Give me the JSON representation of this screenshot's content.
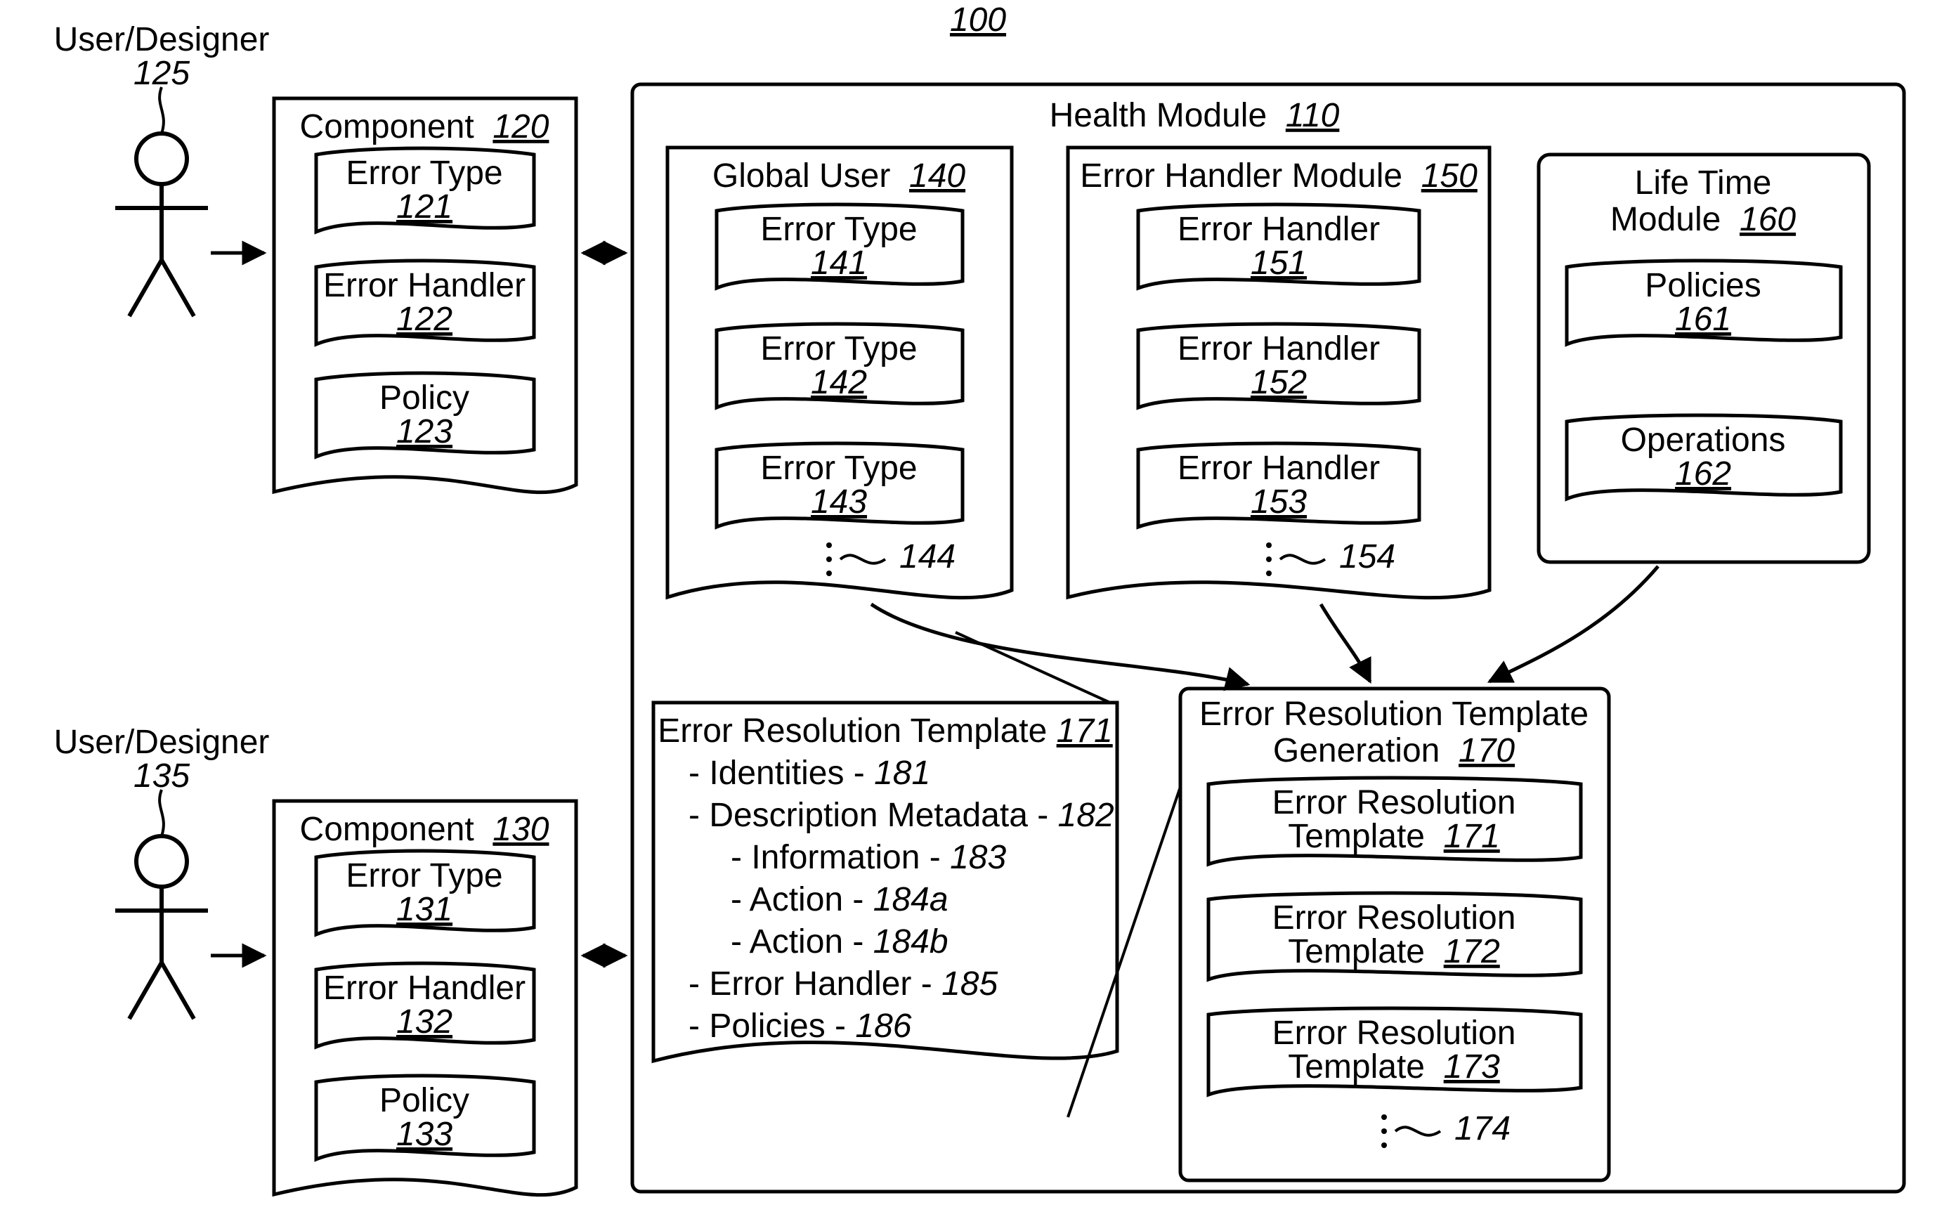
{
  "diagram_ref": "100",
  "user1": {
    "label": "User/Designer",
    "ref": "125"
  },
  "user2": {
    "label": "User/Designer",
    "ref": "135"
  },
  "component1": {
    "title": "Component",
    "ref": "120",
    "items": [
      {
        "label": "Error Type",
        "ref": "121"
      },
      {
        "label": "Error Handler",
        "ref": "122"
      },
      {
        "label": "Policy",
        "ref": "123"
      }
    ]
  },
  "component2": {
    "title": "Component",
    "ref": "130",
    "items": [
      {
        "label": "Error Type",
        "ref": "131"
      },
      {
        "label": "Error Handler",
        "ref": "132"
      },
      {
        "label": "Policy",
        "ref": "133"
      }
    ]
  },
  "health": {
    "title": "Health Module",
    "ref": "110"
  },
  "global_user": {
    "title": "Global User",
    "ref": "140",
    "items": [
      {
        "label": "Error Type",
        "ref": "141"
      },
      {
        "label": "Error Type",
        "ref": "142"
      },
      {
        "label": "Error Type",
        "ref": "143"
      }
    ],
    "more_ref": "144"
  },
  "ehm": {
    "title": "Error Handler Module",
    "ref": "150",
    "items": [
      {
        "label": "Error Handler",
        "ref": "151"
      },
      {
        "label": "Error Handler",
        "ref": "152"
      },
      {
        "label": "Error Handler",
        "ref": "153"
      }
    ],
    "more_ref": "154"
  },
  "lifetime": {
    "title_line1": "Life Time",
    "title_line2": "Module",
    "ref": "160",
    "items": [
      {
        "label": "Policies",
        "ref": "161"
      },
      {
        "label": "Operations",
        "ref": "162"
      }
    ]
  },
  "ert": {
    "title": "Error Resolution Template",
    "ref": "171",
    "lines": [
      {
        "text": "- Identities -",
        "ref": "181",
        "indent": 0
      },
      {
        "text": "- Description Metadata -",
        "ref": "182",
        "indent": 0
      },
      {
        "text": "- Information -",
        "ref": "183",
        "indent": 1
      },
      {
        "text": "- Action -",
        "ref": "184a",
        "indent": 1
      },
      {
        "text": "- Action -",
        "ref": "184b",
        "indent": 1
      },
      {
        "text": "- Error Handler -",
        "ref": "185",
        "indent": 0
      },
      {
        "text": "- Policies -",
        "ref": "186",
        "indent": 0
      }
    ]
  },
  "ertg": {
    "title_line1": "Error Resolution Template",
    "title_line2": "Generation",
    "ref": "170",
    "items": [
      {
        "label_line1": "Error Resolution",
        "label_line2": "Template",
        "ref": "171"
      },
      {
        "label_line1": "Error Resolution",
        "label_line2": "Template",
        "ref": "172"
      },
      {
        "label_line1": "Error Resolution",
        "label_line2": "Template",
        "ref": "173"
      }
    ],
    "more_ref": "174"
  }
}
